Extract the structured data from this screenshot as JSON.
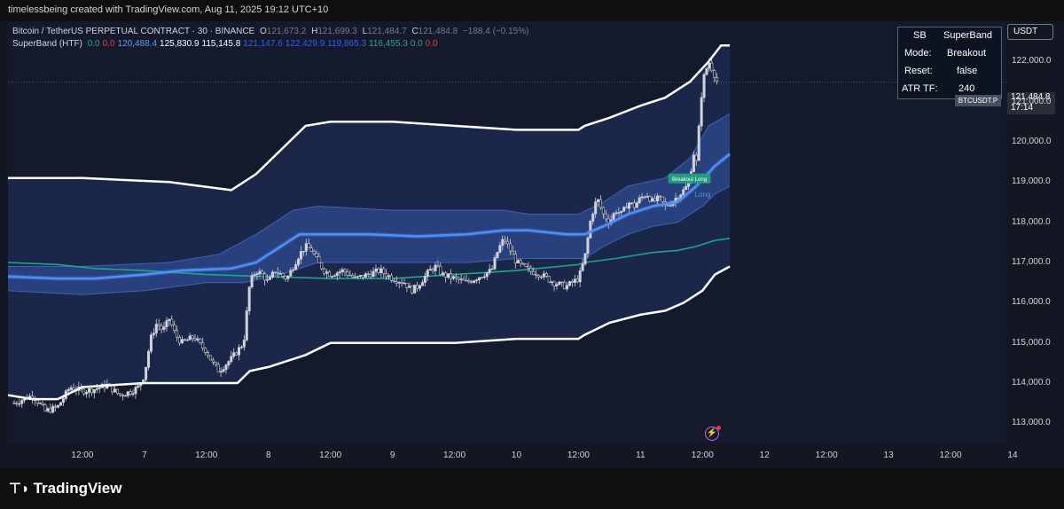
{
  "header": {
    "attribution": "timelessbeing created with TradingView.com, Aug 11, 2025 19:12 UTC+10"
  },
  "legend": {
    "symbol_line": "Bitcoin / TetherUS PERPETUAL CONTRACT · 30 · BINANCE",
    "o_label": "O",
    "o_value": "121,673.2",
    "h_label": "H",
    "h_value": "121,699.3",
    "l_label": "L",
    "l_value": "121,484.7",
    "c_label": "C",
    "c_value": "121,484.8",
    "change": "−188.4 (−0.15%)",
    "indicator_name": "SuperBand (HTF)",
    "indicator_values": [
      {
        "text": "0.0",
        "color": "#26a69a"
      },
      {
        "text": "0.0",
        "color": "#f23645"
      },
      {
        "text": "120,488.4",
        "color": "#5b9cf6"
      },
      {
        "text": "125,830.9",
        "color": "#ffffff"
      },
      {
        "text": "115,145.8",
        "color": "#ffffff"
      },
      {
        "text": "121,147.6",
        "color": "#2962ff"
      },
      {
        "text": "122,429.9",
        "color": "#2962ff"
      },
      {
        "text": "119,865.3",
        "color": "#2962ff"
      },
      {
        "text": "116,455.3",
        "color": "#26a69a"
      },
      {
        "text": "0.0",
        "color": "#26a69a"
      },
      {
        "text": "0.0",
        "color": "#f23645"
      }
    ]
  },
  "info_table": {
    "rows": [
      {
        "key": "SB",
        "value": "SuperBand"
      },
      {
        "key": "Mode:",
        "value": "Breakout"
      },
      {
        "key": "Reset:",
        "value": "false"
      },
      {
        "key": "ATR TF:",
        "value": "240"
      }
    ]
  },
  "currency_button": "USDT",
  "price_tag": {
    "price": "121,484.8",
    "countdown": "17:14",
    "symbol": "BTCUSDT.P"
  },
  "markers": {
    "breakout_label": "Breakout Long",
    "signal_label": "Long"
  },
  "brand": "TradingView",
  "alert_icon": "lightning-alert-icon",
  "colors": {
    "outer_band": "#ffffff",
    "inner_band_fill": "#2e4a8e",
    "basis": "#4f8ff7",
    "slow_ma": "#17a989",
    "candle": "#d1d4dc",
    "breakout_marker": "#1f9e7e"
  },
  "chart_data": {
    "type": "candlestick",
    "symbol": "BTCUSDT.P",
    "interval": "30",
    "ylim": [
      112500,
      123000
    ],
    "y_ticks": [
      113000,
      114000,
      115000,
      116000,
      117000,
      118000,
      119000,
      120000,
      121000,
      122000
    ],
    "y_tick_labels": [
      "113,000.0",
      "114,000.0",
      "115,000.0",
      "116,000.0",
      "117,000.0",
      "118,000.0",
      "119,000.0",
      "120,000.0",
      "121,000.0",
      "122,000.0"
    ],
    "x_range_days": [
      5.9,
      13.95
    ],
    "x_ticks": [
      {
        "t": 6.5,
        "label": "12:00"
      },
      {
        "t": 7.0,
        "label": "7"
      },
      {
        "t": 7.5,
        "label": "12:00"
      },
      {
        "t": 8.0,
        "label": "8"
      },
      {
        "t": 8.5,
        "label": "12:00"
      },
      {
        "t": 9.0,
        "label": "9"
      },
      {
        "t": 9.5,
        "label": "12:00"
      },
      {
        "t": 10.0,
        "label": "10"
      },
      {
        "t": 10.5,
        "label": "12:00"
      },
      {
        "t": 11.0,
        "label": "11"
      },
      {
        "t": 11.5,
        "label": "12:00"
      },
      {
        "t": 12.0,
        "label": "12"
      },
      {
        "t": 12.5,
        "label": "12:00"
      },
      {
        "t": 13.0,
        "label": "13"
      },
      {
        "t": 13.5,
        "label": "12:00"
      },
      {
        "t": 14.0,
        "label": "14"
      }
    ],
    "price_series": [
      [
        5.95,
        113500
      ],
      [
        6.1,
        113700
      ],
      [
        6.2,
        113300
      ],
      [
        6.3,
        113400
      ],
      [
        6.4,
        113900
      ],
      [
        6.5,
        113800
      ],
      [
        6.6,
        113850
      ],
      [
        6.7,
        113950
      ],
      [
        6.8,
        113700
      ],
      [
        6.9,
        113800
      ],
      [
        6.95,
        113900
      ],
      [
        7.0,
        114200
      ],
      [
        7.05,
        115100
      ],
      [
        7.1,
        115500
      ],
      [
        7.15,
        115300
      ],
      [
        7.2,
        115600
      ],
      [
        7.25,
        115200
      ],
      [
        7.3,
        115000
      ],
      [
        7.4,
        115150
      ],
      [
        7.45,
        114950
      ],
      [
        7.5,
        114800
      ],
      [
        7.55,
        114500
      ],
      [
        7.6,
        114300
      ],
      [
        7.65,
        114450
      ],
      [
        7.7,
        114600
      ],
      [
        7.75,
        114800
      ],
      [
        7.8,
        115000
      ],
      [
        7.85,
        116500
      ],
      [
        7.9,
        116800
      ],
      [
        7.95,
        116700
      ],
      [
        8.0,
        116500
      ],
      [
        8.05,
        116800
      ],
      [
        8.1,
        116700
      ],
      [
        8.15,
        116600
      ],
      [
        8.2,
        116900
      ],
      [
        8.25,
        117200
      ],
      [
        8.3,
        117400
      ],
      [
        8.35,
        117300
      ],
      [
        8.4,
        117000
      ],
      [
        8.45,
        116800
      ],
      [
        8.5,
        116700
      ],
      [
        8.6,
        116800
      ],
      [
        8.7,
        116600
      ],
      [
        8.8,
        116700
      ],
      [
        8.9,
        116800
      ],
      [
        9.0,
        116600
      ],
      [
        9.1,
        116500
      ],
      [
        9.15,
        116300
      ],
      [
        9.2,
        116400
      ],
      [
        9.25,
        116600
      ],
      [
        9.3,
        116800
      ],
      [
        9.35,
        116900
      ],
      [
        9.4,
        116700
      ],
      [
        9.5,
        116600
      ],
      [
        9.6,
        116500
      ],
      [
        9.7,
        116650
      ],
      [
        9.8,
        116800
      ],
      [
        9.85,
        117300
      ],
      [
        9.9,
        117600
      ],
      [
        9.95,
        117300
      ],
      [
        10.0,
        117000
      ],
      [
        10.1,
        116800
      ],
      [
        10.2,
        116700
      ],
      [
        10.3,
        116500
      ],
      [
        10.4,
        116400
      ],
      [
        10.45,
        116500
      ],
      [
        10.5,
        116600
      ],
      [
        10.55,
        117100
      ],
      [
        10.6,
        118100
      ],
      [
        10.65,
        118600
      ],
      [
        10.7,
        118200
      ],
      [
        10.75,
        118000
      ],
      [
        10.8,
        118300
      ],
      [
        10.85,
        118200
      ],
      [
        10.9,
        118500
      ],
      [
        10.95,
        118400
      ],
      [
        11.0,
        118600
      ],
      [
        11.05,
        118700
      ],
      [
        11.1,
        118500
      ],
      [
        11.15,
        118600
      ],
      [
        11.2,
        118400
      ],
      [
        11.25,
        118500
      ],
      [
        11.3,
        118650
      ],
      [
        11.35,
        118800
      ],
      [
        11.4,
        119000
      ],
      [
        11.42,
        119800
      ],
      [
        11.45,
        119500
      ],
      [
        11.5,
        121500
      ],
      [
        11.55,
        122000
      ],
      [
        11.58,
        121800
      ],
      [
        11.62,
        121484.8
      ]
    ],
    "outer_upper": [
      [
        5.9,
        119100
      ],
      [
        6.5,
        119100
      ],
      [
        7.2,
        119000
      ],
      [
        7.7,
        118800
      ],
      [
        7.9,
        119200
      ],
      [
        8.1,
        119800
      ],
      [
        8.3,
        120400
      ],
      [
        8.5,
        120500
      ],
      [
        9.0,
        120500
      ],
      [
        9.5,
        120400
      ],
      [
        10.0,
        120300
      ],
      [
        10.5,
        120300
      ],
      [
        10.55,
        120400
      ],
      [
        10.75,
        120600
      ],
      [
        11.0,
        120900
      ],
      [
        11.2,
        121100
      ],
      [
        11.4,
        121500
      ],
      [
        11.55,
        122000
      ],
      [
        11.65,
        122400
      ],
      [
        11.72,
        122400
      ]
    ],
    "outer_lower": [
      [
        5.9,
        113700
      ],
      [
        6.1,
        113600
      ],
      [
        6.3,
        113600
      ],
      [
        6.5,
        113900
      ],
      [
        7.0,
        114000
      ],
      [
        7.5,
        114000
      ],
      [
        7.75,
        114000
      ],
      [
        7.85,
        114300
      ],
      [
        8.0,
        114400
      ],
      [
        8.3,
        114700
      ],
      [
        8.5,
        115000
      ],
      [
        9.0,
        115000
      ],
      [
        9.5,
        115000
      ],
      [
        10.0,
        115100
      ],
      [
        10.5,
        115100
      ],
      [
        10.55,
        115200
      ],
      [
        10.75,
        115500
      ],
      [
        11.0,
        115700
      ],
      [
        11.2,
        115800
      ],
      [
        11.35,
        116000
      ],
      [
        11.5,
        116300
      ],
      [
        11.6,
        116700
      ],
      [
        11.72,
        116900
      ]
    ],
    "basis": [
      [
        5.9,
        116650
      ],
      [
        6.3,
        116600
      ],
      [
        6.6,
        116600
      ],
      [
        7.0,
        116700
      ],
      [
        7.3,
        116800
      ],
      [
        7.7,
        116850
      ],
      [
        7.9,
        117000
      ],
      [
        8.1,
        117400
      ],
      [
        8.25,
        117700
      ],
      [
        8.4,
        117700
      ],
      [
        8.8,
        117700
      ],
      [
        9.2,
        117650
      ],
      [
        9.6,
        117700
      ],
      [
        9.9,
        117800
      ],
      [
        10.1,
        117800
      ],
      [
        10.4,
        117700
      ],
      [
        10.55,
        117700
      ],
      [
        10.7,
        117900
      ],
      [
        10.9,
        118200
      ],
      [
        11.1,
        118400
      ],
      [
        11.3,
        118500
      ],
      [
        11.45,
        118900
      ],
      [
        11.6,
        119400
      ],
      [
        11.72,
        119700
      ]
    ],
    "inner_upper": [
      [
        5.9,
        116900
      ],
      [
        6.5,
        116900
      ],
      [
        7.2,
        117000
      ],
      [
        7.6,
        117200
      ],
      [
        7.9,
        117700
      ],
      [
        8.2,
        118300
      ],
      [
        8.4,
        118400
      ],
      [
        9.0,
        118300
      ],
      [
        9.5,
        118300
      ],
      [
        9.9,
        118300
      ],
      [
        10.1,
        118200
      ],
      [
        10.5,
        118200
      ],
      [
        10.7,
        118500
      ],
      [
        10.9,
        118900
      ],
      [
        11.2,
        119100
      ],
      [
        11.4,
        119600
      ],
      [
        11.55,
        120400
      ],
      [
        11.72,
        120700
      ]
    ],
    "inner_lower": [
      [
        5.9,
        116300
      ],
      [
        6.5,
        116200
      ],
      [
        7.0,
        116300
      ],
      [
        7.5,
        116500
      ],
      [
        7.8,
        116500
      ],
      [
        8.1,
        116700
      ],
      [
        8.4,
        117000
      ],
      [
        8.8,
        117000
      ],
      [
        9.2,
        117000
      ],
      [
        9.6,
        117000
      ],
      [
        10.0,
        117100
      ],
      [
        10.4,
        117100
      ],
      [
        10.55,
        117100
      ],
      [
        10.7,
        117400
      ],
      [
        10.9,
        117700
      ],
      [
        11.1,
        117900
      ],
      [
        11.3,
        118000
      ],
      [
        11.5,
        118400
      ],
      [
        11.6,
        118700
      ],
      [
        11.72,
        118900
      ]
    ],
    "slow_ma": [
      [
        5.9,
        117000
      ],
      [
        6.3,
        116950
      ],
      [
        6.6,
        116850
      ],
      [
        7.0,
        116800
      ],
      [
        7.5,
        116700
      ],
      [
        8.0,
        116650
      ],
      [
        8.5,
        116600
      ],
      [
        9.0,
        116600
      ],
      [
        9.5,
        116700
      ],
      [
        10.0,
        116800
      ],
      [
        10.5,
        116950
      ],
      [
        10.55,
        117000
      ],
      [
        10.8,
        117100
      ],
      [
        11.1,
        117250
      ],
      [
        11.3,
        117300
      ],
      [
        11.45,
        117400
      ],
      [
        11.6,
        117550
      ],
      [
        11.72,
        117600
      ]
    ],
    "breakout_marker": {
      "t": 11.38,
      "price": 119100
    },
    "last_price": 121484.8
  }
}
